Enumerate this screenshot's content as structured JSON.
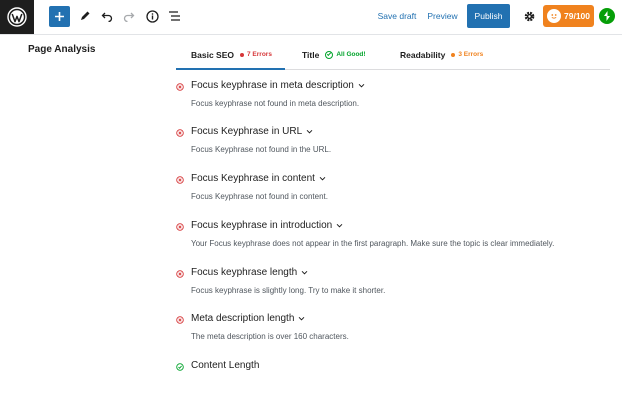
{
  "toolbar": {
    "save_draft": "Save draft",
    "preview": "Preview",
    "publish": "Publish",
    "seo_score": "79/100"
  },
  "sidebar": {
    "title": "Page Analysis"
  },
  "tabs": [
    {
      "label": "Basic SEO",
      "badge": "7 Errors",
      "badge_color": "#d63638"
    },
    {
      "label": "Title",
      "badge": "All Good!",
      "badge_color": "#00a32a"
    },
    {
      "label": "Readability",
      "badge": "3 Errors",
      "badge_color": "#f0821e"
    }
  ],
  "checks": [
    {
      "status": "error",
      "title": "Focus keyphrase in meta description",
      "desc": "Focus keyphrase not found in meta description."
    },
    {
      "status": "error",
      "title": "Focus Keyphrase in URL",
      "desc": "Focus Keyphrase not found in the URL."
    },
    {
      "status": "error",
      "title": "Focus Keyphrase in content",
      "desc": "Focus Keyphrase not found in content."
    },
    {
      "status": "error",
      "title": "Focus keyphrase in introduction",
      "desc": "Your Focus keyphrase does not appear in the first paragraph. Make sure the topic is clear immediately."
    },
    {
      "status": "error",
      "title": "Focus keyphrase length",
      "desc": "Focus keyphrase is slightly long. Try to make it shorter."
    },
    {
      "status": "error",
      "title": "Meta description length",
      "desc": "The meta description is over 160 characters."
    },
    {
      "status": "good",
      "title": "Content Length",
      "desc": ""
    }
  ],
  "colors": {
    "error": "#d63638",
    "good": "#00a32a",
    "accent": "#2271b1",
    "seo_badge": "#f0821e"
  }
}
